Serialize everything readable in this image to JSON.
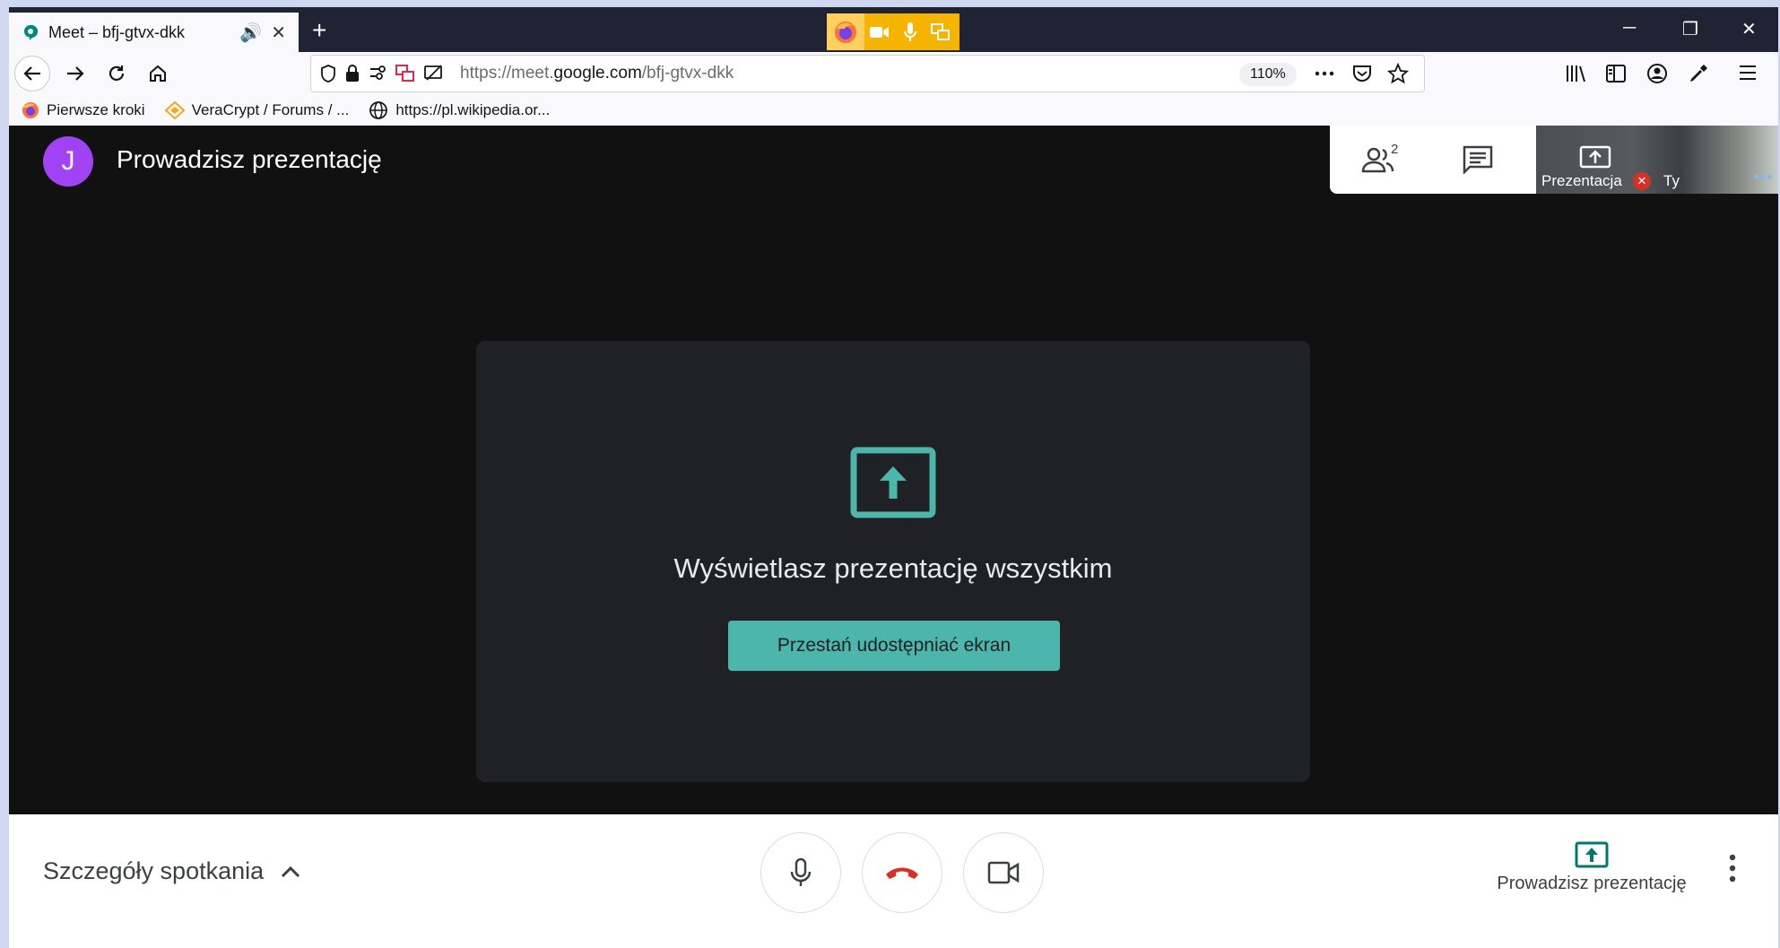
{
  "browser": {
    "tab_title": "Meet – bfj-gtvx-dkk",
    "url_prefix": "https://meet.",
    "url_domain": "google.com",
    "url_path": "/bfj-gtvx-dkk",
    "zoom": "110%",
    "bookmarks": [
      {
        "label": "Pierwsze kroki",
        "icon": "firefox-icon"
      },
      {
        "label": "VeraCrypt / Forums / ...",
        "icon": "veracrypt-icon"
      },
      {
        "label": "https://pl.wikipedia.or...",
        "icon": "globe-icon"
      }
    ]
  },
  "meet": {
    "avatar_initial": "J",
    "header_title": "Prowadzisz prezentację",
    "participants_count": "2",
    "selfview_label": "Prezentacja",
    "selfview_you": "Ty",
    "card_message": "Wyświetlasz prezentację wszystkim",
    "stop_button": "Przestań udostępniać ekran",
    "details_label": "Szczegóły spotkania",
    "presenting_label": "Prowadzisz prezentację"
  },
  "colors": {
    "accent": "#4db6ac",
    "avatar": "#a142f4",
    "hangup": "#d93025",
    "background": "#111111",
    "card": "#202124"
  }
}
